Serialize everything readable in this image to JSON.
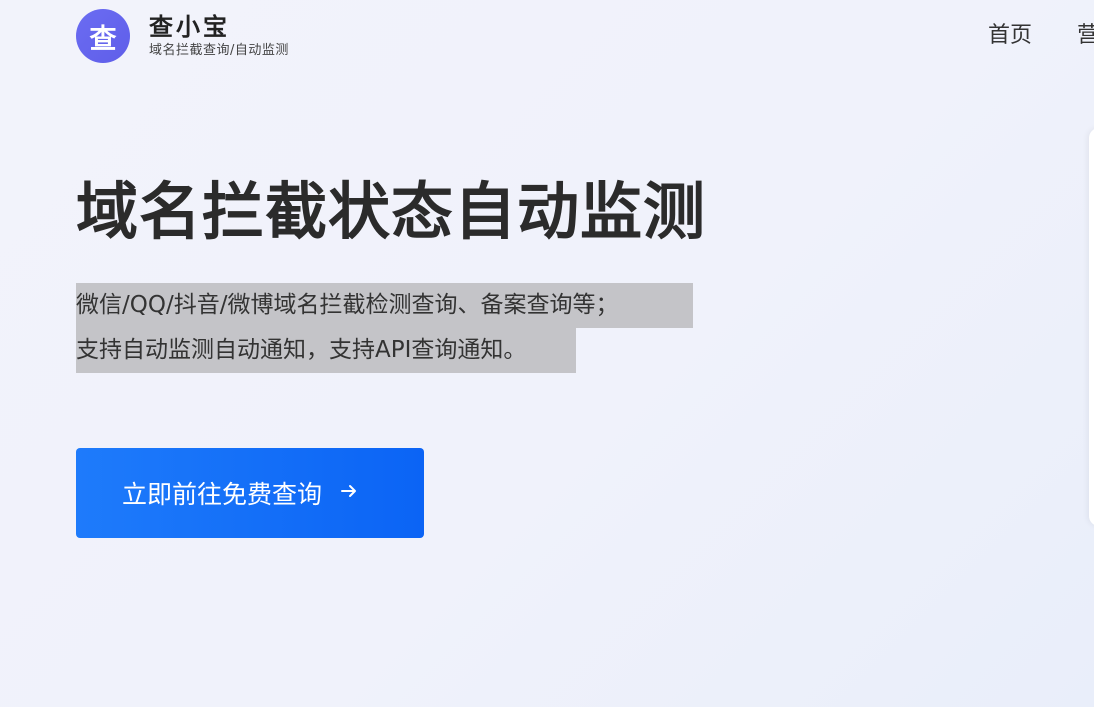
{
  "brand": {
    "logo_char": "查",
    "name": "查小宝",
    "tagline": "域名拦截查询/自动监测",
    "accent": "#6b6cf2"
  },
  "nav": {
    "items": [
      "首页",
      "营"
    ]
  },
  "hero": {
    "title": "域名拦截状态自动监测",
    "desc_line1": "微信/QQ/抖音/微博域名拦截检测查询、备案查询等；",
    "desc_line2": "支持自动监测自动通知，支持API查询通知。",
    "cta_label": "立即前往免费查询",
    "cta_icon": "arrow-right-icon",
    "cta_color": "#1e7bfb"
  }
}
